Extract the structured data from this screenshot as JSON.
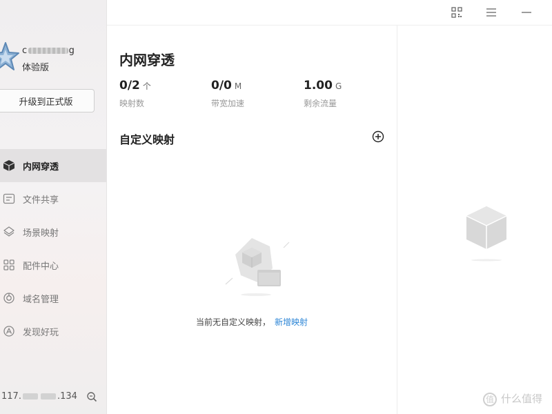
{
  "user": {
    "name_prefix": "c",
    "name_suffix": "g",
    "plan": "体验版",
    "upgrade_label": "升级到正式版"
  },
  "nav": [
    {
      "label": "内网穿透",
      "icon": "cube-icon",
      "active": true
    },
    {
      "label": "文件共享",
      "icon": "file-share-icon",
      "active": false
    },
    {
      "label": "场景映射",
      "icon": "scene-icon",
      "active": false
    },
    {
      "label": "配件中心",
      "icon": "apps-grid-icon",
      "active": false
    },
    {
      "label": "域名管理",
      "icon": "domain-icon",
      "active": false
    },
    {
      "label": "发现好玩",
      "icon": "discover-icon",
      "active": false
    }
  ],
  "footer": {
    "ip_prefix": "117.",
    "ip_suffix": ".134"
  },
  "topbar": {
    "icons": [
      "qr-code-icon",
      "menu-icon",
      "minimize-icon"
    ]
  },
  "main": {
    "title": "内网穿透",
    "stats": [
      {
        "value": "0/2",
        "unit": "个",
        "caption": "映射数"
      },
      {
        "value": "0/0",
        "unit": "M",
        "caption": "带宽加速"
      },
      {
        "value": "1.00",
        "unit": "G",
        "caption": "剩余流量"
      }
    ],
    "section_title": "自定义映射",
    "empty_text": "当前无自定义映射，",
    "empty_link": "新增映射"
  },
  "watermark": {
    "logo": "值",
    "text": "什么值得"
  },
  "colors": {
    "accent": "#2d86d6",
    "sidebar_bg": "#f1eff0",
    "active_bg": "#e3e1e2"
  }
}
